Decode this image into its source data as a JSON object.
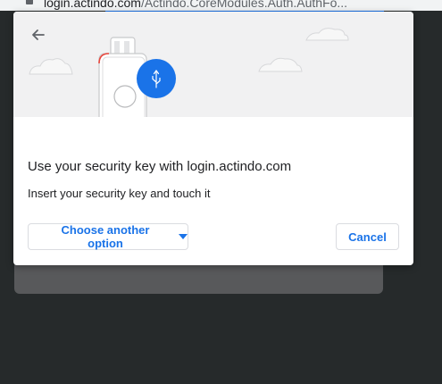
{
  "browser": {
    "url_host": "login.actindo.com",
    "url_path": "/Actindo.CoreModules.Auth.AuthFo..."
  },
  "dialog": {
    "back_icon": "arrow-back-icon",
    "illustration": "security-key-usb-icon",
    "title": "Use your security key with login.actindo.com",
    "subtitle": "Insert your security key and touch it",
    "choose_option_label": "Choose another option",
    "cancel_label": "Cancel"
  },
  "colors": {
    "accent": "#1a73e8",
    "hero_bg": "#f1f1f2",
    "backdrop": "#262a2b",
    "page_panel": "#58595b"
  }
}
